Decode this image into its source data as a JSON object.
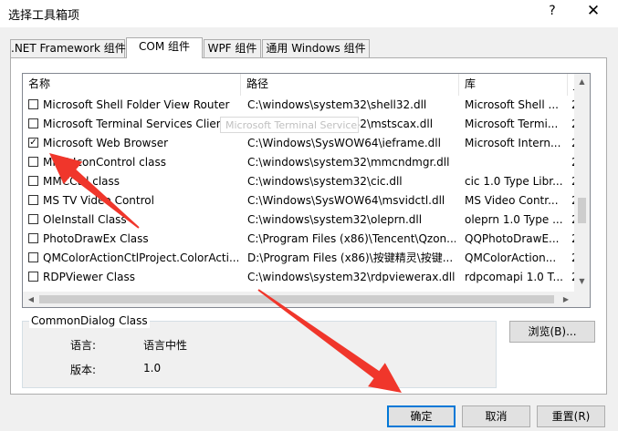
{
  "window": {
    "title": "选择工具箱项",
    "help": "?",
    "close": "✕"
  },
  "tabs": [
    {
      "label": ".NET Framework 组件",
      "active": false
    },
    {
      "label": "COM 组件",
      "active": true
    },
    {
      "label": "WPF 组件",
      "active": false
    },
    {
      "label": "通用 Windows 组件",
      "active": false
    }
  ],
  "table": {
    "columns": [
      "名称",
      "路径",
      "库",
      "_"
    ],
    "rows": [
      {
        "checked": false,
        "name": "Microsoft Shell Folder View Router",
        "path": "C:\\windows\\system32\\shell32.dll",
        "library": "Microsoft Shell ...",
        "extra": "2"
      },
      {
        "checked": false,
        "name": "Microsoft Terminal Services Client Control",
        "path": "C:\\windows\\system32\\mstscax.dll",
        "library": "Microsoft Termi...",
        "extra": "2"
      },
      {
        "checked": true,
        "name": "Microsoft Web Browser",
        "path": "C:\\Windows\\SysWOW64\\ieframe.dll",
        "library": "Microsoft Intern...",
        "extra": "2"
      },
      {
        "checked": false,
        "name": "MMC IconControl class",
        "path": "C:\\windows\\system32\\mmcndmgr.dll",
        "library": "",
        "extra": "2"
      },
      {
        "checked": false,
        "name": "MMCCtrl class",
        "path": "C:\\windows\\system32\\cic.dll",
        "library": "cic 1.0 Type Libr...",
        "extra": "2"
      },
      {
        "checked": false,
        "name": "MS TV Video Control",
        "path": "C:\\Windows\\SysWOW64\\msvidctl.dll",
        "library": "MS Video Contr...",
        "extra": "2"
      },
      {
        "checked": false,
        "name": "OleInstall Class",
        "path": "C:\\windows\\system32\\oleprn.dll",
        "library": "oleprn 1.0 Type ...",
        "extra": "2"
      },
      {
        "checked": false,
        "name": "PhotoDrawEx Class",
        "path": "C:\\Program Files (x86)\\Tencent\\Qzon...",
        "library": "QQPhotoDrawE...",
        "extra": "2"
      },
      {
        "checked": false,
        "name": "QMColorActionCtlProject.ColorActi...",
        "path": "D:\\Program Files (x86)\\按键精灵\\按键...",
        "library": "QMColorAction...",
        "extra": "2"
      },
      {
        "checked": false,
        "name": "RDPViewer Class",
        "path": "C:\\windows\\system32\\rdpviewerax.dll",
        "library": "rdpcomapi 1.0 T...",
        "extra": "2"
      }
    ]
  },
  "tooltip": "Microsoft Terminal Services Client Control",
  "details": {
    "title": "CommonDialog Class",
    "language_label": "语言:",
    "language_value": "语言中性",
    "version_label": "版本:",
    "version_value": "1.0"
  },
  "buttons": {
    "browse": "浏览(B)...",
    "ok": "确定",
    "cancel": "取消",
    "reset": "重置(R)"
  },
  "colors": {
    "arrow": "#f0362b",
    "accent": "#0078d7"
  },
  "icons": {
    "help": "help-icon",
    "close": "close-icon",
    "check": "checkmark-icon",
    "scroll": "scroll-arrow-icon",
    "arrow": "red-arrow-annotation"
  }
}
